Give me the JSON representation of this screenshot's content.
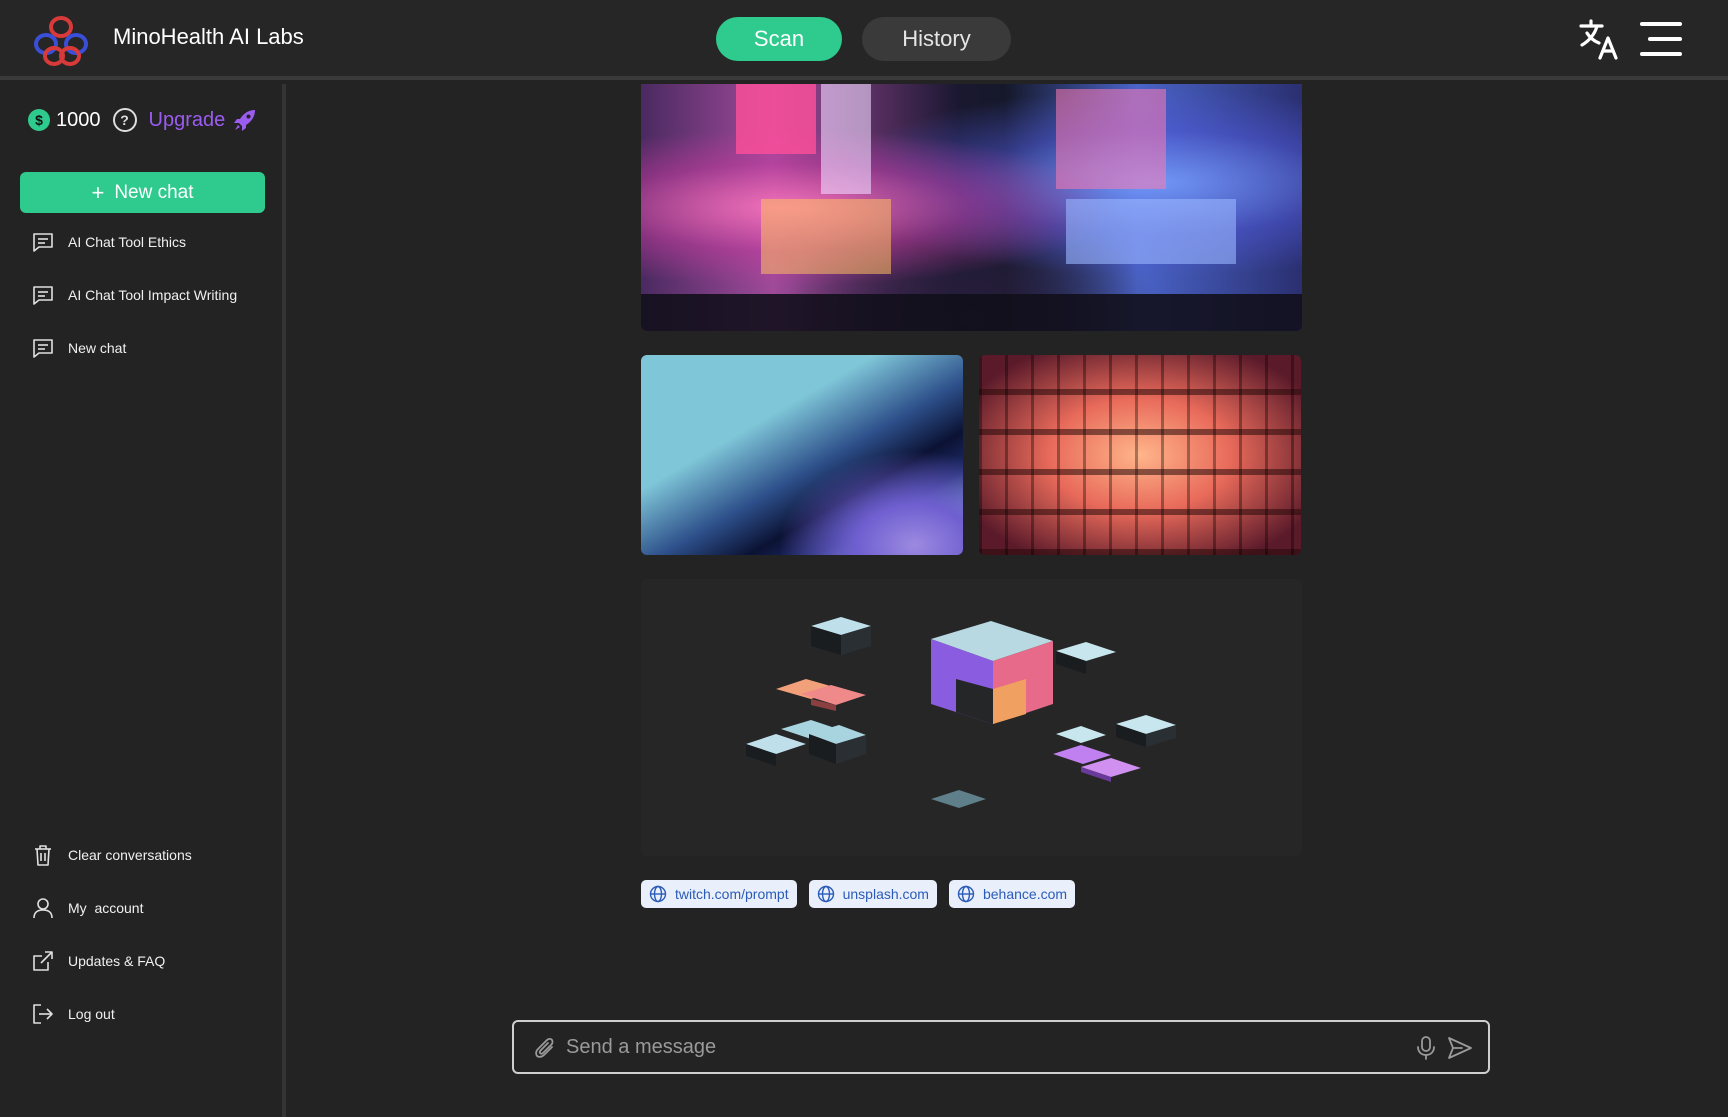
{
  "header": {
    "brand": "MinoHealth AI Labs",
    "tabs": [
      {
        "label": "Scan",
        "active": true
      },
      {
        "label": "History",
        "active": false
      }
    ],
    "icons": [
      "logo-icon",
      "translate-icon",
      "menu-icon"
    ]
  },
  "sidebar": {
    "credits": "1000",
    "coin_symbol": "$",
    "help_symbol": "?",
    "upgrade_label": "Upgrade",
    "new_chat_label": "New chat",
    "chats": [
      {
        "label": "AI Chat Tool Ethics"
      },
      {
        "label": "AI Chat Tool Impact Writing"
      },
      {
        "label": "New chat"
      }
    ],
    "actions": [
      {
        "label": "Clear conversations",
        "icon": "trash-icon"
      },
      {
        "label": "My  account",
        "icon": "user-icon"
      },
      {
        "label": "Updates & FAQ",
        "icon": "external-link-icon"
      },
      {
        "label": "Log out",
        "icon": "logout-icon"
      }
    ]
  },
  "main": {
    "images": [
      {
        "name": "image-neon-city-street"
      },
      {
        "name": "image-abstract-blue-wave"
      },
      {
        "name": "image-japanese-lanterns"
      },
      {
        "name": "image-isometric-cubes"
      }
    ],
    "sources": [
      {
        "label": "twitch.com/prompt"
      },
      {
        "label": "unsplash.com"
      },
      {
        "label": "behance.com"
      }
    ]
  },
  "composer": {
    "placeholder": "Send a message"
  },
  "colors": {
    "accent": "#2fca8d",
    "upgrade": "#9b5cf0",
    "background": "#232323",
    "chip_bg": "#e9f0fb",
    "chip_text": "#2b5bb8"
  }
}
